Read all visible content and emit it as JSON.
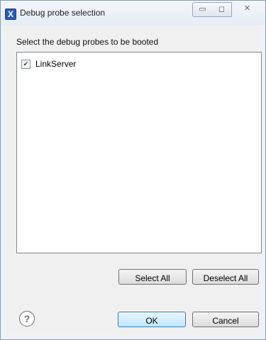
{
  "window": {
    "title": "Debug probe selection",
    "app_icon": "X",
    "minimize_icon": "▭",
    "maximize_icon": "◻",
    "close_icon": "✕"
  },
  "dialog": {
    "prompt": "Select the debug probes to be booted",
    "probes": [
      {
        "label": "LinkServer",
        "checked": true,
        "check_glyph": "✔"
      }
    ],
    "buttons": {
      "select_all": "Select All",
      "deselect_all": "Deselect All",
      "ok": "OK",
      "cancel": "Cancel"
    },
    "help_icon": "?"
  },
  "colors": {
    "ok_button_border": "#3c7fb1",
    "app_icon_blue": "#2a5bb6"
  }
}
